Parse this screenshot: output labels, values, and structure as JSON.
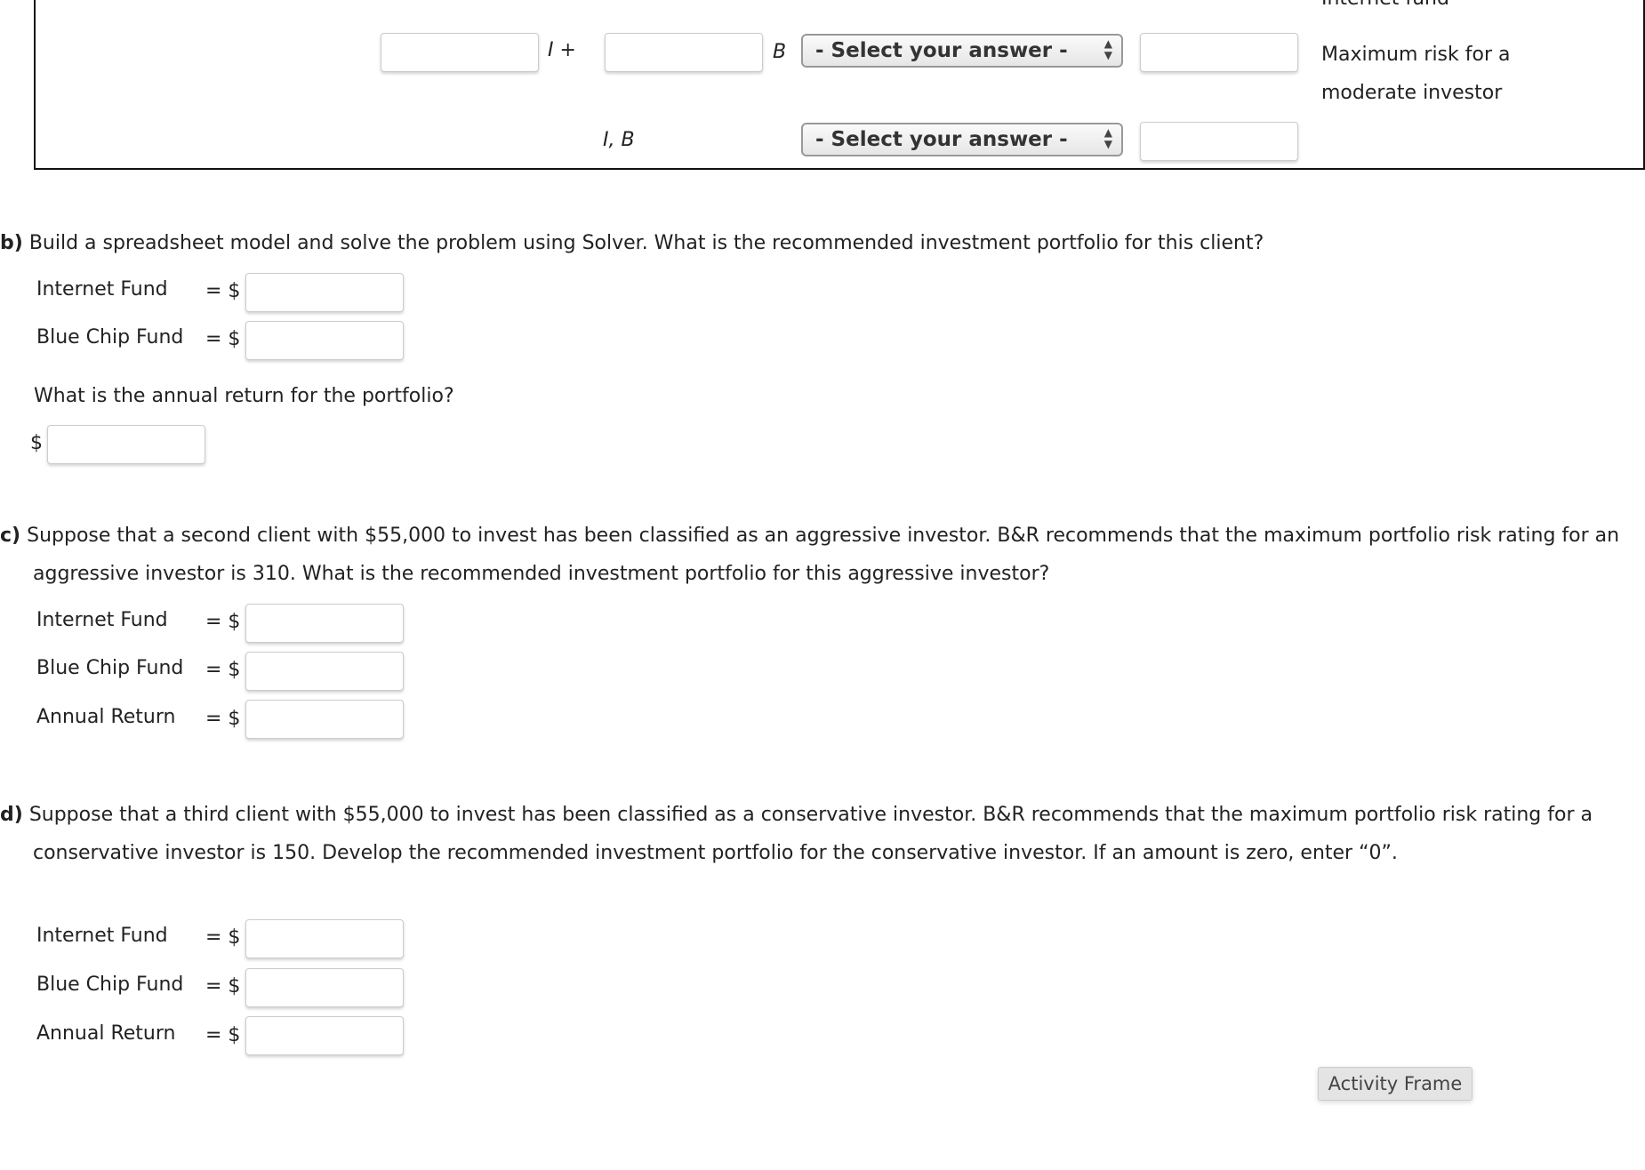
{
  "constraint_table": {
    "top_cutoff_label": "Internet fund",
    "row1": {
      "var1": "I +",
      "var2": "B",
      "select": "- Select your answer -",
      "description": "Maximum risk for a moderate investor"
    },
    "row2": {
      "vars": "I, B",
      "select": "- Select your answer -"
    }
  },
  "part_b": {
    "label": "b)",
    "question": "Build a spreadsheet model and solve the problem using Solver. What is the recommended investment portfolio for this client?",
    "fields": [
      {
        "label": "Internet Fund",
        "eq": "= $"
      },
      {
        "label": "Blue Chip Fund",
        "eq": "= $"
      }
    ],
    "return_question": "What is the annual return for the portfolio?",
    "return_prefix": "$"
  },
  "part_c": {
    "label": "c)",
    "question": "Suppose that a second client with $55,000 to invest has been classified as an aggressive investor. B&R recommends that the maximum portfolio risk rating for an aggressive investor is 310. What is the recommended investment portfolio for this aggressive investor?",
    "fields": [
      {
        "label": "Internet Fund",
        "eq": "= $"
      },
      {
        "label": "Blue Chip Fund",
        "eq": "= $"
      },
      {
        "label": "Annual Return",
        "eq": "= $"
      }
    ]
  },
  "part_d": {
    "label": "d)",
    "question": "Suppose that a third client with $55,000 to invest has been classified as a conservative investor. B&R recommends that the maximum portfolio risk rating for a conservative investor is 150. Develop the recommended investment portfolio for the conservative investor. If an amount is zero, enter “0”.",
    "fields": [
      {
        "label": "Internet Fund",
        "eq": "= $"
      },
      {
        "label": "Blue Chip Fund",
        "eq": "= $"
      },
      {
        "label": "Annual Return",
        "eq": "= $"
      }
    ]
  },
  "activity_frame_button": "Activity Frame"
}
